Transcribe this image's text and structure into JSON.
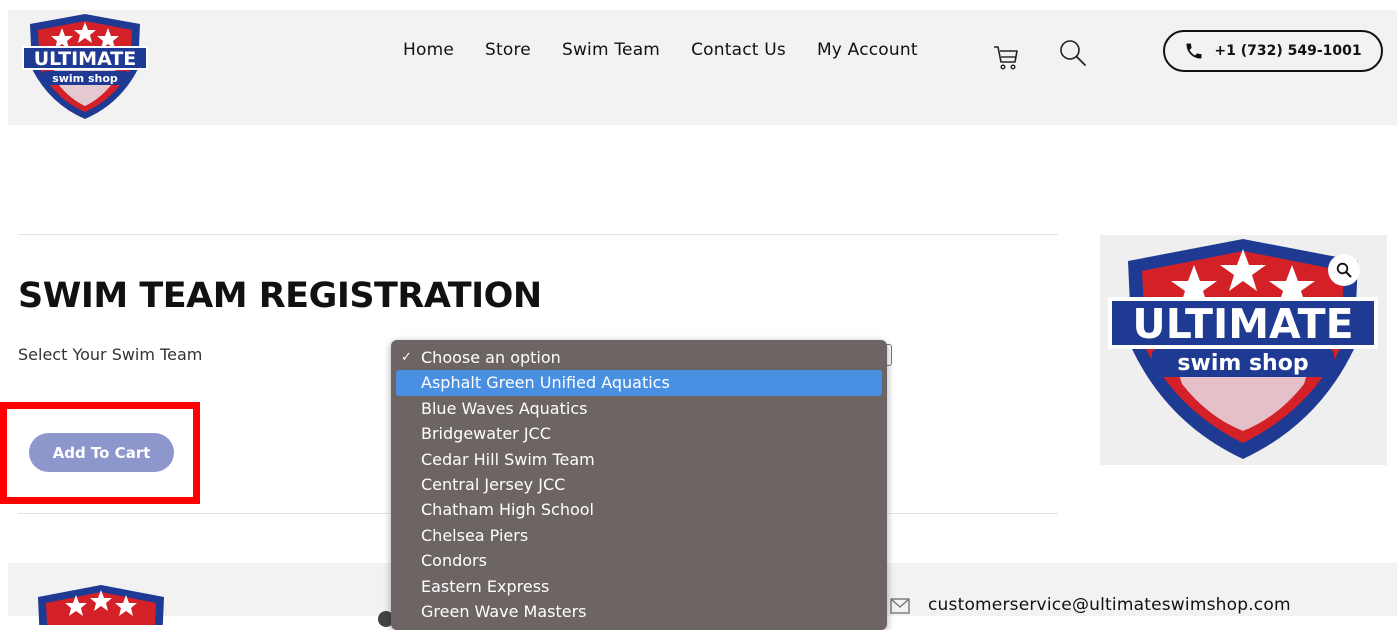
{
  "header": {
    "logo_text_top": "ULTIMATE",
    "logo_text_bottom": "swim shop",
    "nav": [
      "Home",
      "Store",
      "Swim Team",
      "Contact Us",
      "My Account"
    ],
    "phone": "+1 (732) 549-1001"
  },
  "main": {
    "title": "SWIM TEAM REGISTRATION",
    "field_label": "Select Your Swim Team",
    "add_to_cart": "Add To Cart"
  },
  "dropdown": {
    "check": "✓",
    "options": [
      "Choose an option",
      "Asphalt Green Unified Aquatics",
      "Blue Waves Aquatics",
      "Bridgewater JCC",
      "Cedar Hill Swim Team",
      "Central Jersey JCC",
      "Chatham High School",
      "Chelsea Piers",
      "Condors",
      "Eastern Express",
      "Green Wave Masters"
    ],
    "checked_index": 0,
    "highlighted_index": 1
  },
  "footer": {
    "email": "customerservice@ultimateswimshop.com"
  },
  "colors": {
    "brand_blue": "#1f3a93",
    "brand_red": "#d42027",
    "button": "#8e97cc",
    "highlight_box": "#ff0000",
    "dropdown_bg": "#6c6564",
    "dropdown_selected": "#4a90e2"
  },
  "icons": [
    "cart-icon",
    "search-icon",
    "phone-icon",
    "zoom-icon",
    "mail-icon",
    "check-icon"
  ]
}
